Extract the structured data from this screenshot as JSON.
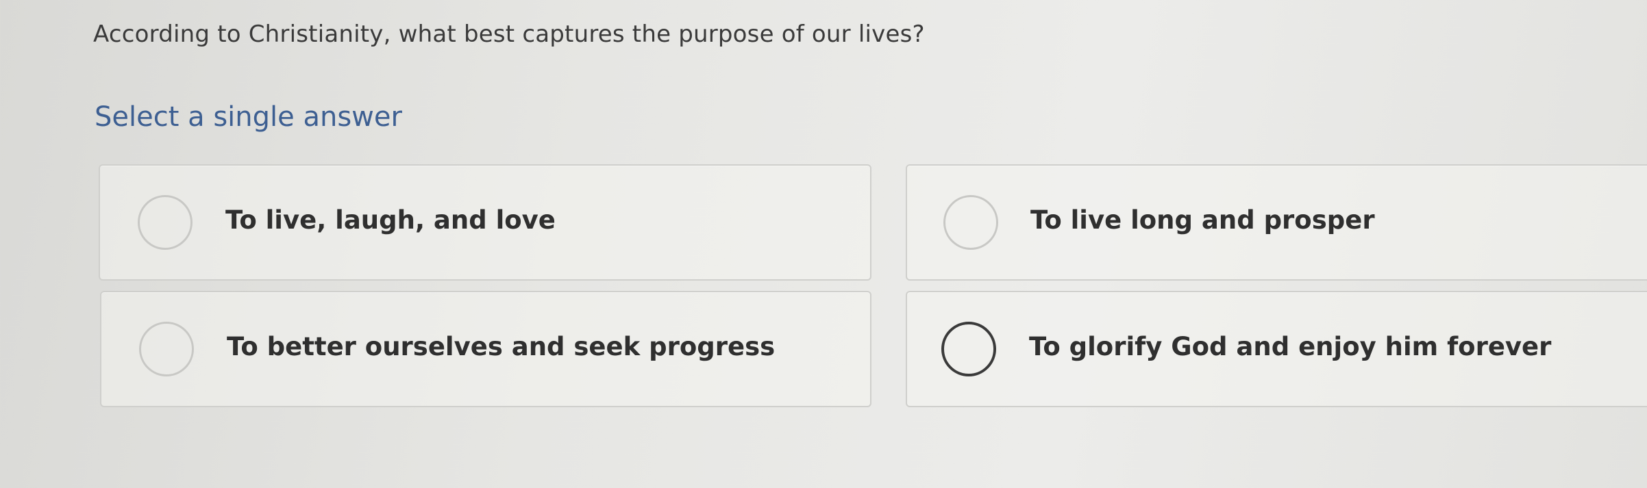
{
  "question": {
    "text": "According to Christianity, what best captures the purpose of our lives?"
  },
  "instruction": "Select a single answer",
  "options": [
    {
      "label": "To live, laugh, and love"
    },
    {
      "label": "To live long and prosper"
    },
    {
      "label": "To better ourselves and seek progress"
    },
    {
      "label": "To glorify God and enjoy him forever"
    }
  ]
}
